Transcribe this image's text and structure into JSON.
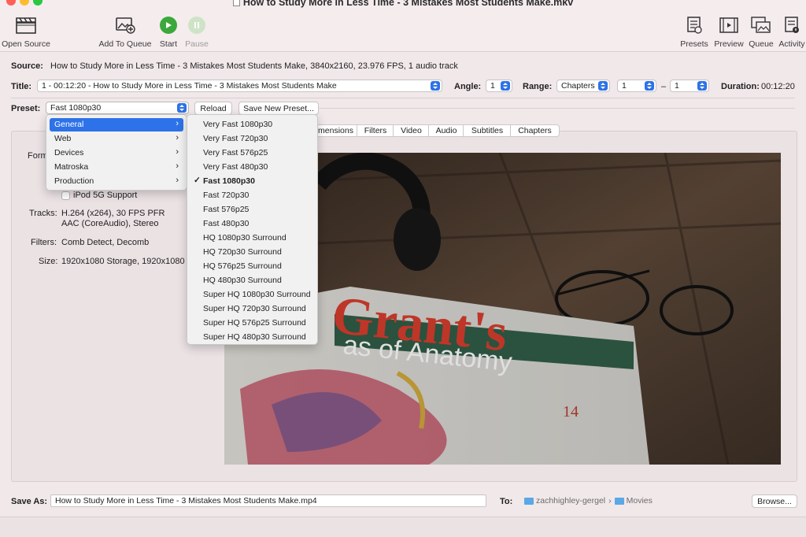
{
  "window": {
    "title": "How to Study More in Less Time - 3 Mistakes Most Students Make.mkv",
    "colors": {
      "close": "#fe5f57",
      "minimize": "#febc2e",
      "zoom": "#28c840"
    }
  },
  "toolbar": {
    "open_source": "Open Source",
    "add_to_queue": "Add To Queue",
    "start": "Start",
    "pause": "Pause",
    "presets": "Presets",
    "preview": "Preview",
    "queue": "Queue",
    "activity": "Activity"
  },
  "source": {
    "label": "Source:",
    "value": "How to Study More in Less Time - 3 Mistakes Most Students Make, 3840x2160, 23.976 FPS, 1 audio track"
  },
  "title_row": {
    "label": "Title:",
    "value": "1 - 00:12:20 - How to Study More in Less Time - 3 Mistakes Most Students Make",
    "angle_label": "Angle:",
    "angle": "1",
    "range_label": "Range:",
    "range_type": "Chapters",
    "range_start": "1",
    "range_sep": "–",
    "range_end": "1",
    "duration_label": "Duration:",
    "duration": "00:12:20"
  },
  "preset_row": {
    "label": "Preset:",
    "value": "Fast 1080p30",
    "reload": "Reload",
    "save_new": "Save New Preset..."
  },
  "tabs": [
    "mensions",
    "Filters",
    "Video",
    "Audio",
    "Subtitles",
    "Chapters"
  ],
  "summary": {
    "format_label": "Form",
    "ipod_label": "iPod 5G Support",
    "tracks_label": "Tracks:",
    "tracks_line1": "H.264 (x264), 30 FPS PFR",
    "tracks_line2": "AAC (CoreAudio), Stereo",
    "filters_label": "Filters:",
    "filters": "Comb Detect, Decomb",
    "size_label": "Size:",
    "size": "1920x1080 Storage, 1920x1080 Di"
  },
  "preset_categories": [
    "General",
    "Web",
    "Devices",
    "Matroska",
    "Production"
  ],
  "preset_submenu": [
    "Very Fast 1080p30",
    "Very Fast 720p30",
    "Very Fast 576p25",
    "Very Fast 480p30",
    "Fast 1080p30",
    "Fast 720p30",
    "Fast 576p25",
    "Fast 480p30",
    "HQ 1080p30 Surround",
    "HQ 720p30 Surround",
    "HQ 576p25 Surround",
    "HQ 480p30 Surround",
    "Super HQ 1080p30 Surround",
    "Super HQ 720p30 Surround",
    "Super HQ 576p25 Surround",
    "Super HQ 480p30 Surround"
  ],
  "preview_book": {
    "title_part1": "Grant's",
    "title_part2": "as of Anatomy",
    "edition": "14"
  },
  "save": {
    "label": "Save As:",
    "filename": "How to Study More in Less Time - 3 Mistakes Most Students Make.mp4",
    "to_label": "To:",
    "user_folder": "zachhighley-gergel",
    "folder": "Movies",
    "browse": "Browse..."
  },
  "colors": {
    "accent": "#2d72e8",
    "start_green": "#3aa83a"
  }
}
